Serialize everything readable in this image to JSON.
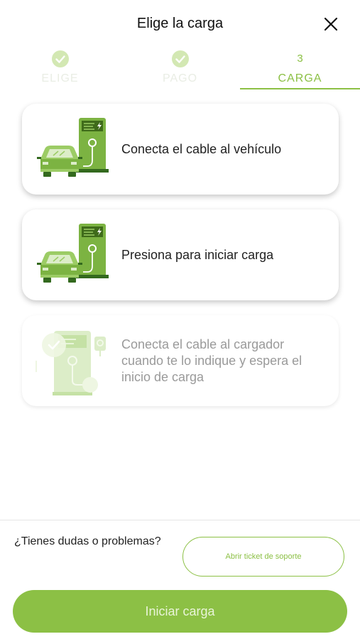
{
  "header": {
    "title": "Elige la carga",
    "close_icon": "close-icon"
  },
  "stepper": {
    "steps": [
      {
        "label": "ELIGE",
        "state": "done",
        "icon": "check-icon"
      },
      {
        "label": "PAGO",
        "state": "done",
        "icon": "check-icon"
      },
      {
        "number": "3",
        "label": "CARGA",
        "state": "active"
      }
    ],
    "accent_color": "#8cc045"
  },
  "instructions": [
    {
      "text": "Conecta el cable al vehículo",
      "icon": "car-charging-icon",
      "state": "active"
    },
    {
      "text": "Presiona para iniciar carga",
      "icon": "car-charging-icon",
      "state": "active"
    },
    {
      "text": "Conecta el cable al cargador cuando te lo indique y espera el inicio de carga",
      "icon": "charger-plug-icon",
      "state": "pending"
    }
  ],
  "support": {
    "question": "¿Tienes dudas o problemas?",
    "button_label": "Abrir ticket de soporte"
  },
  "footer": {
    "primary_button": "Iniciar carga"
  }
}
